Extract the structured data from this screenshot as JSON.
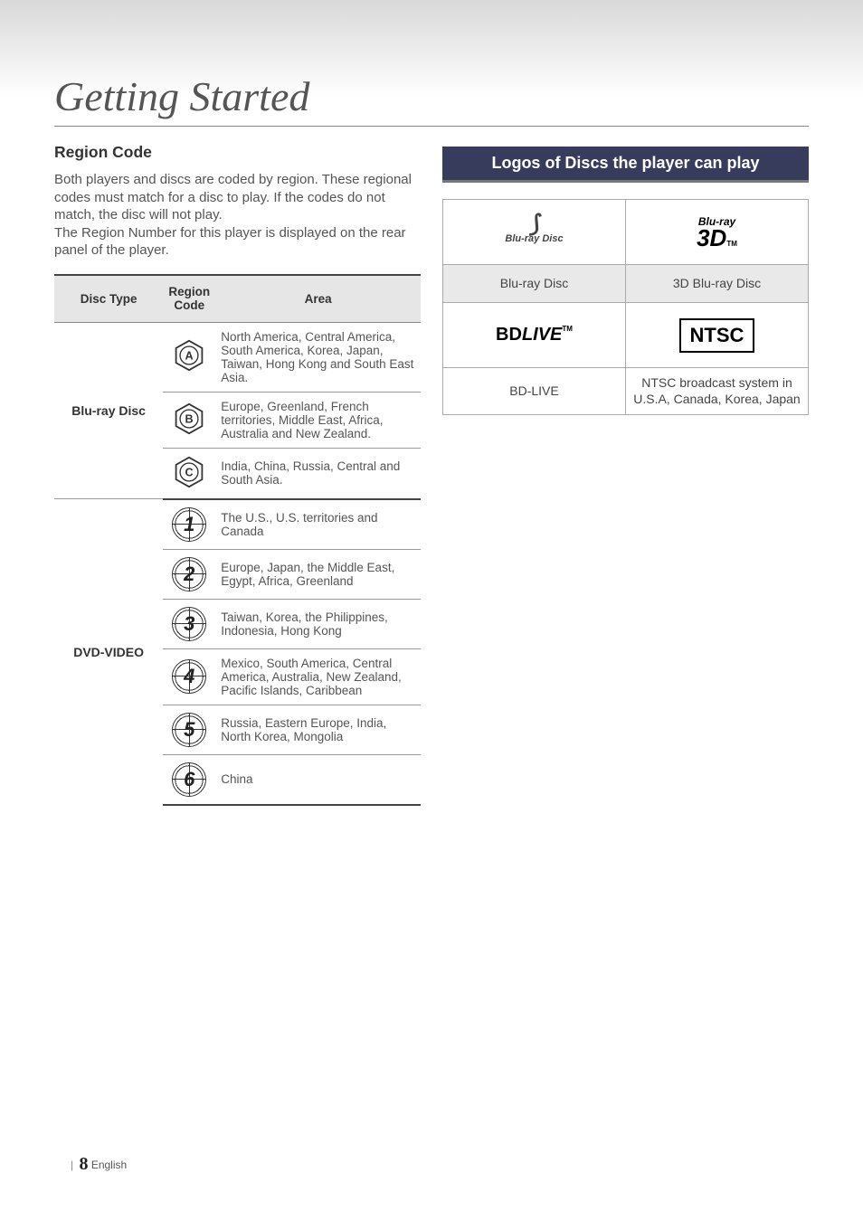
{
  "page_title": "Getting Started",
  "region_section": {
    "heading": "Region Code",
    "paragraph": "Both players and discs are coded by region. These regional codes must match for a disc to play. If the codes do not match, the disc will not play.\nThe Region Number for this player is displayed on the rear panel of the player."
  },
  "region_table": {
    "headers": {
      "disc_type": "Disc Type",
      "region_code": "Region\nCode",
      "area": "Area"
    },
    "groups": [
      {
        "disc_type": "Blu-ray Disc",
        "rows": [
          {
            "code_label": "A",
            "code_style": "hex",
            "area": "North America, Central America, South America, Korea, Japan, Taiwan, Hong Kong and South East Asia."
          },
          {
            "code_label": "B",
            "code_style": "hex",
            "area": "Europe, Greenland, French territories, Middle East, Africa, Australia and New Zealand."
          },
          {
            "code_label": "C",
            "code_style": "hex",
            "area": "India, China, Russia, Central and South Asia."
          }
        ]
      },
      {
        "disc_type": "DVD-VIDEO",
        "rows": [
          {
            "code_label": "1",
            "code_style": "globe",
            "area": "The U.S., U.S. territories and Canada"
          },
          {
            "code_label": "2",
            "code_style": "globe",
            "area": "Europe, Japan, the Middle East, Egypt, Africa, Greenland"
          },
          {
            "code_label": "3",
            "code_style": "globe",
            "area": "Taiwan, Korea, the Philippines, Indonesia, Hong Kong"
          },
          {
            "code_label": "4",
            "code_style": "globe",
            "area": "Mexico, South America, Central America, Australia, New Zealand, Pacific Islands, Caribbean"
          },
          {
            "code_label": "5",
            "code_style": "globe",
            "area": "Russia, Eastern Europe, India, North Korea, Mongolia"
          },
          {
            "code_label": "6",
            "code_style": "globe",
            "area": "China"
          }
        ]
      }
    ]
  },
  "logos_section": {
    "heading": "Logos of Discs the player can play",
    "rows": [
      {
        "left_label": "Blu-ray Disc",
        "right_label": "3D Blu-ray Disc"
      },
      {
        "left_label": "BD-LIVE",
        "right_label": "NTSC broadcast system in U.S.A, Canada, Korea, Japan"
      }
    ]
  },
  "footer": {
    "page_number": "8",
    "language": "English"
  },
  "icons": {
    "bluray_disc_logo": "Blu-ray Disc",
    "bluray_3d_top": "Blu-ray",
    "bluray_3d_main": "3D",
    "bdlive_prefix": "BD",
    "bdlive_main": "LIVE",
    "bdlive_tm": "TM",
    "ntsc": "NTSC",
    "tm": "TM"
  }
}
